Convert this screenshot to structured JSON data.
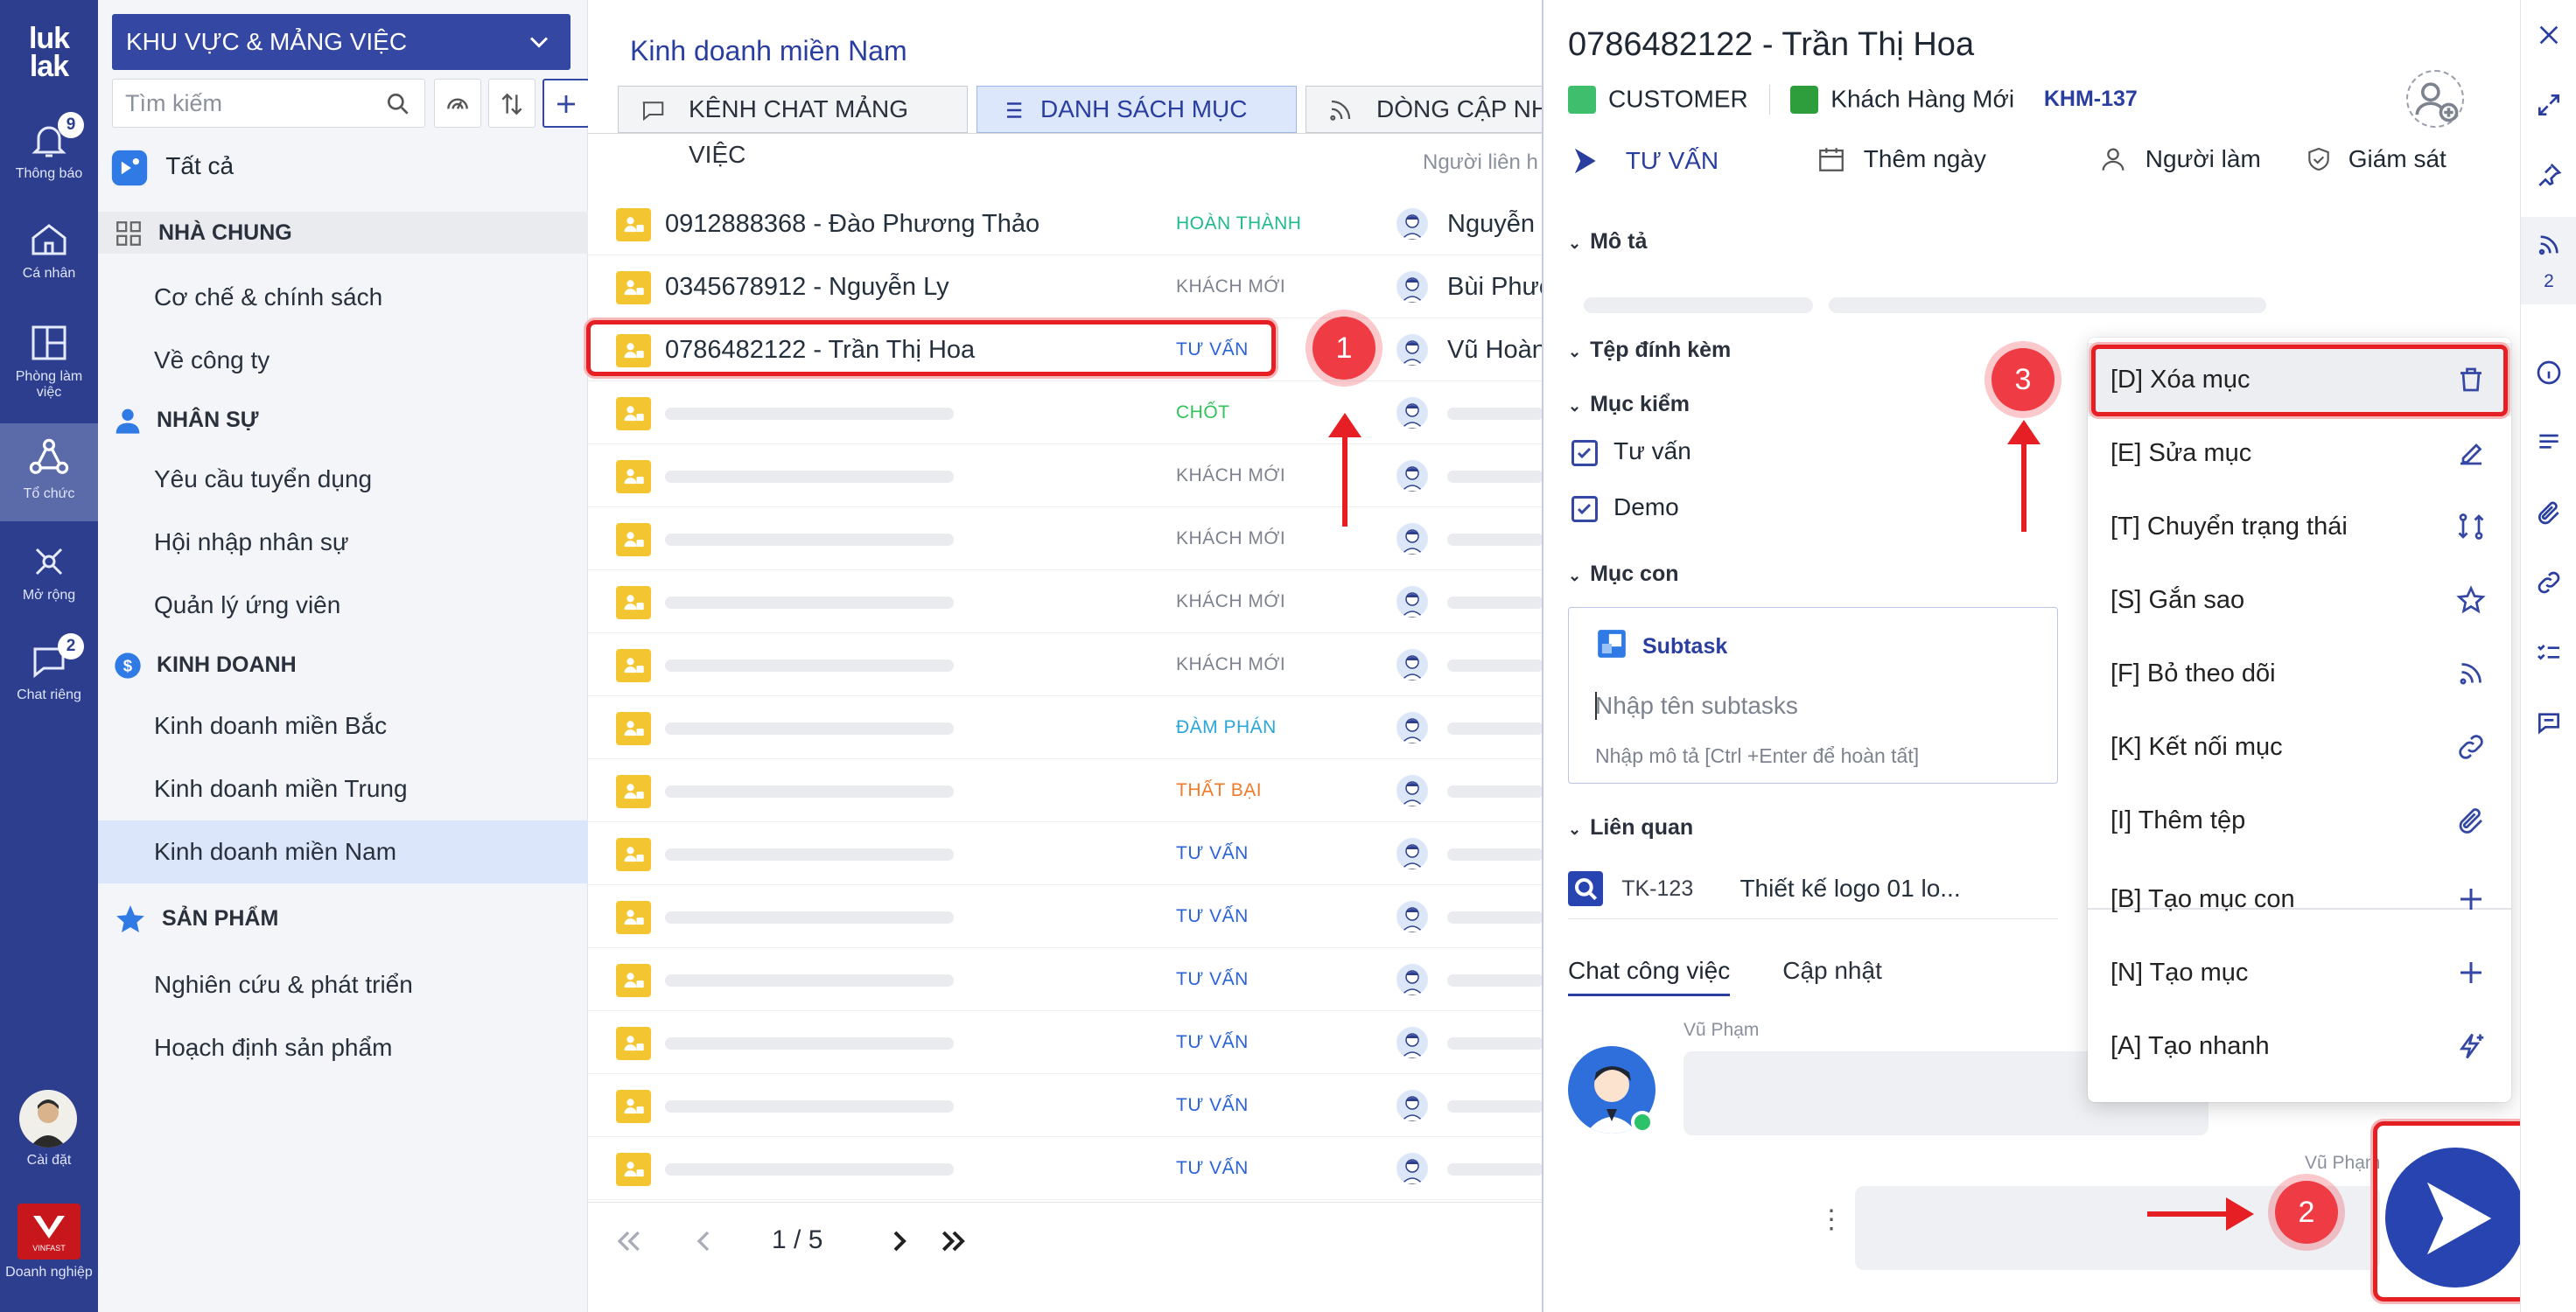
{
  "rail": {
    "logo_line1": "luk",
    "logo_line2": "lak",
    "items": [
      {
        "label": "Thông báo",
        "badge": "9"
      },
      {
        "label": "Cá nhân"
      },
      {
        "label": "Phòng làm việc"
      },
      {
        "label": "Tổ chức"
      },
      {
        "label": "Mở rộng"
      },
      {
        "label": "Chat riêng",
        "badge": "2"
      }
    ],
    "settings_label": "Cài đặt",
    "enterprise_label": "Doanh nghiệp",
    "enterprise_logo_text": "VINFAST"
  },
  "sidebar": {
    "workspace_select": "KHU VỰC & MẢNG VIỆC",
    "search_placeholder": "Tìm kiếm",
    "all_label": "Tất cả",
    "groups": [
      {
        "title": "NHÀ CHUNG",
        "items": [
          "Cơ chế & chính sách",
          "Về công ty"
        ]
      },
      {
        "title": "NHÂN SỰ",
        "items": [
          "Yêu cầu tuyển dụng",
          "Hội nhập nhân sự",
          "Quản lý ứng viên"
        ]
      },
      {
        "title": "KINH DOANH",
        "items": [
          "Kinh doanh miền Bắc",
          "Kinh doanh miền Trung",
          "Kinh doanh miền Nam"
        ]
      },
      {
        "title": "SẢN PHẨM",
        "items": [
          "Nghiên cứu & phát triển",
          "Hoạch định sản phẩm"
        ]
      }
    ]
  },
  "list": {
    "title": "Kinh doanh miền Nam",
    "tabs": [
      "KÊNH CHAT MẢNG VIỆC",
      "DANH SÁCH MỤC",
      "DÒNG CẬP NHẬT"
    ],
    "column_header": "Người liên h",
    "rows": [
      {
        "title": "0912888368 - Đào Phương Thảo",
        "status": "HOÀN THÀNH",
        "person": "Nguyễn"
      },
      {
        "title": "0345678912 - Nguyễn Ly",
        "status": "KHÁCH MỚI",
        "person": "Bùi Phươ"
      },
      {
        "title": "0786482122 - Trần Thị Hoa",
        "status": "TƯ VẤN",
        "person": "Vũ Hoàn"
      },
      {
        "title": "",
        "status": "CHỐT",
        "person": ""
      },
      {
        "title": "",
        "status": "KHÁCH MỚI",
        "person": ""
      },
      {
        "title": "",
        "status": "KHÁCH MỚI",
        "person": ""
      },
      {
        "title": "",
        "status": "KHÁCH MỚI",
        "person": ""
      },
      {
        "title": "",
        "status": "KHÁCH MỚI",
        "person": ""
      },
      {
        "title": "",
        "status": "ĐÀM PHÁN",
        "person": ""
      },
      {
        "title": "",
        "status": "THẤT BẠI",
        "person": ""
      },
      {
        "title": "",
        "status": "TƯ VẤN",
        "person": ""
      },
      {
        "title": "",
        "status": "TƯ VẤN",
        "person": ""
      },
      {
        "title": "",
        "status": "TƯ VẤN",
        "person": ""
      },
      {
        "title": "",
        "status": "TƯ VẤN",
        "person": ""
      },
      {
        "title": "",
        "status": "TƯ VẤN",
        "person": ""
      },
      {
        "title": "",
        "status": "TƯ VẤN",
        "person": ""
      }
    ],
    "status_colors": {
      "HOÀN THÀNH": "#1fba8c",
      "KHÁCH MỚI": "#7d838e",
      "TƯ VẤN": "#2a62d8",
      "CHỐT": "#33c25a",
      "ĐÀM PHÁN": "#2aa6d8",
      "THẤT BẠI": "#f07a2a"
    },
    "pagination": "1 / 5"
  },
  "detail": {
    "title": "0786482122 - Trần Thị Hoa",
    "type": "CUSTOMER",
    "stage": "Khách Hàng Mới",
    "code": "KHM-137",
    "status": "TƯ VẤN",
    "add_date": "Thêm ngày",
    "assignee": "Người làm",
    "watcher": "Giám sát",
    "sections": {
      "description": "Mô tả",
      "attachments": "Tệp đính kèm",
      "checklist": "Mục kiểm",
      "subtasks": "Mục con",
      "related": "Liên quan"
    },
    "checklist": [
      {
        "label": "Tư vấn",
        "checked": true
      },
      {
        "label": "Demo",
        "checked": true
      }
    ],
    "subtask": {
      "title": "Subtask",
      "name_placeholder": "Nhập tên subtasks",
      "desc_hint": "Nhập mô tả [Ctrl +Enter để hoàn tất]"
    },
    "related_item": {
      "code": "TK-123",
      "title": "Thiết kế logo 01  lo..."
    },
    "tabs": [
      "Chat công việc",
      "Cập nhật"
    ],
    "chat": {
      "sender": "Vũ Phạm",
      "sender2": "Vũ Phạm"
    }
  },
  "context_menu": {
    "items": [
      {
        "label": "[D] Xóa mục",
        "icon": "trash-icon"
      },
      {
        "label": "[E] Sửa mục",
        "icon": "pencil-icon"
      },
      {
        "label": "[T] Chuyển trạng thái",
        "icon": "transition-icon"
      },
      {
        "label": "[S] Gắn sao",
        "icon": "star-icon"
      },
      {
        "label": "[F] Bỏ theo dõi",
        "icon": "rss-icon"
      },
      {
        "label": "[K] Kết nối mục",
        "icon": "link-icon"
      },
      {
        "label": "[I] Thêm tệp",
        "icon": "paperclip-icon"
      },
      {
        "label": "[B] Tạo mục con",
        "icon": "plus-icon"
      },
      {
        "label": "[N] Tạo mục",
        "icon": "plus-icon"
      },
      {
        "label": "[A] Tạo nhanh",
        "icon": "quick-create-icon"
      }
    ]
  },
  "toolbar_right": {
    "feed_count": "2"
  },
  "annotations": [
    "1",
    "2",
    "3"
  ],
  "colors": {
    "rail_bg": "#2d3e8e",
    "brand_blue": "#3447a3",
    "accent_red": "#e51f23",
    "row_icon": "#f3c531"
  }
}
